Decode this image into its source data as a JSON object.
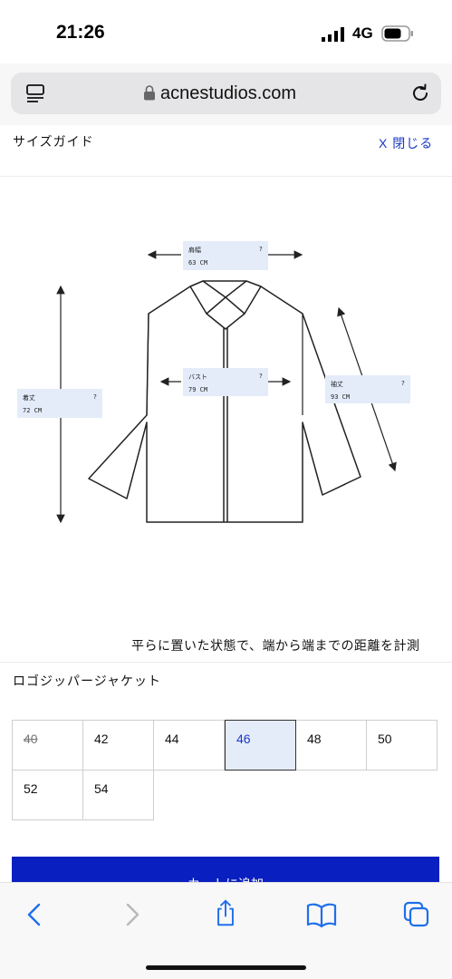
{
  "status_bar": {
    "time": "21:26",
    "network": "4G"
  },
  "browser": {
    "url": "acnestudios.com"
  },
  "size_guide": {
    "title": "サイズガイド",
    "close_label": "X 閉じる",
    "measurements": {
      "shoulder": {
        "label": "肩幅",
        "value": "63 CM",
        "help": "?"
      },
      "bust": {
        "label": "バスト",
        "value": "79 CM",
        "help": "?"
      },
      "length": {
        "label": "着丈",
        "value": "72 CM",
        "help": "?"
      },
      "sleeve": {
        "label": "袖丈",
        "value": "93 CM",
        "help": "?"
      }
    },
    "caption": "平らに置いた状態で、端から端までの距離を計測"
  },
  "product": {
    "name": "ロゴジッパージャケット",
    "sizes": [
      {
        "label": "40",
        "sold_out": true,
        "selected": false
      },
      {
        "label": "42",
        "sold_out": false,
        "selected": false
      },
      {
        "label": "44",
        "sold_out": false,
        "selected": false
      },
      {
        "label": "46",
        "sold_out": false,
        "selected": true
      },
      {
        "label": "48",
        "sold_out": false,
        "selected": false
      },
      {
        "label": "50",
        "sold_out": false,
        "selected": false
      },
      {
        "label": "52",
        "sold_out": false,
        "selected": false
      },
      {
        "label": "54",
        "sold_out": false,
        "selected": false
      }
    ],
    "add_to_cart_label": "カートに追加"
  },
  "colors": {
    "accent": "#1a39c4",
    "button": "#0a1fbf",
    "highlight": "#e4ecfa"
  },
  "toolbar": {
    "icons": [
      "back-icon",
      "forward-icon",
      "share-icon",
      "bookmarks-icon",
      "tabs-icon"
    ]
  }
}
